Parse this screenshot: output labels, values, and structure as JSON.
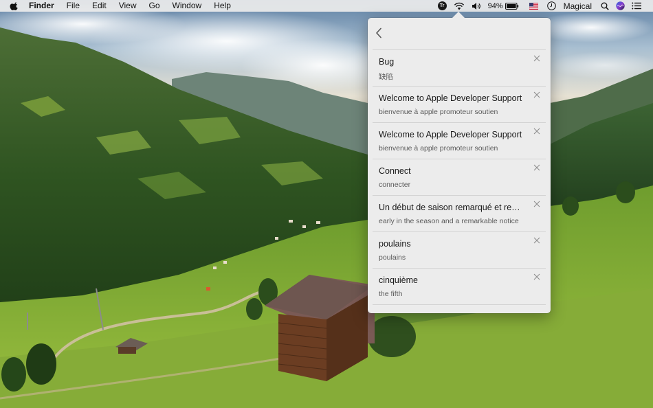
{
  "menubar": {
    "app_name": "Finder",
    "menus": [
      "File",
      "Edit",
      "View",
      "Go",
      "Window",
      "Help"
    ],
    "status": {
      "translator_icon_label": "Tr",
      "battery_percent": "94%",
      "user_name": "Magical"
    }
  },
  "popover": {
    "history": [
      {
        "source": "Bug",
        "translation": "缺陷"
      },
      {
        "source": "Welcome to Apple Developer Support",
        "translation": "bienvenue à apple promoteur soutien"
      },
      {
        "source": "Welcome to Apple Developer Support",
        "translation": "bienvenue à apple promoteur soutien"
      },
      {
        "source": "Connect",
        "translation": "connecter"
      },
      {
        "source": "Un début de saison remarqué et remarquable",
        "translation": "early in the season and a remarkable notice"
      },
      {
        "source": "poulains",
        "translation": "poulains"
      },
      {
        "source": "cinquième",
        "translation": "the fifth"
      }
    ]
  },
  "colors": {
    "popover_bg": "#ececec",
    "divider": "#d3d3d3",
    "menubar_bg": "#ececec"
  }
}
